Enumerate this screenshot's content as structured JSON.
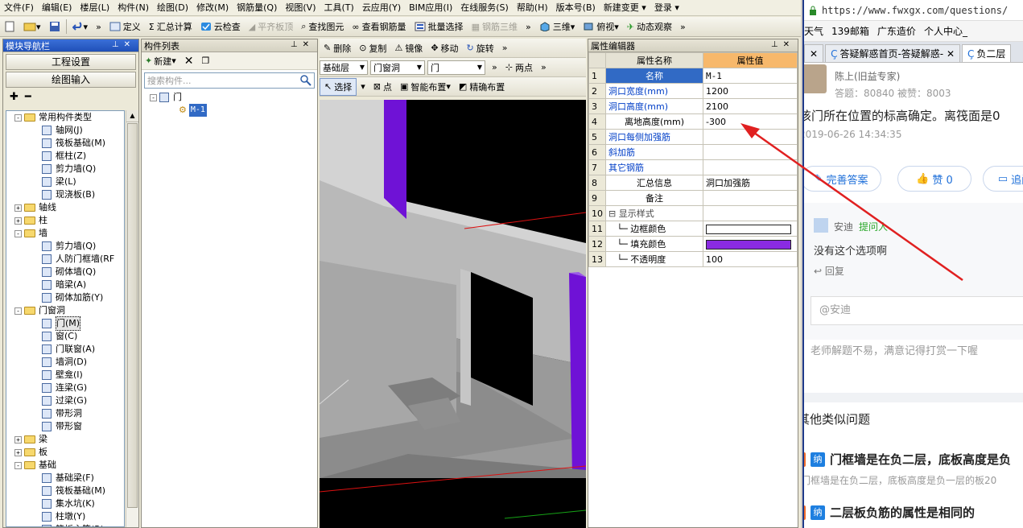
{
  "menu": [
    "文件(F)",
    "编辑(E)",
    "楼层(L)",
    "构件(N)",
    "绘图(D)",
    "修改(M)",
    "钢筋量(Q)",
    "视图(V)",
    "工具(T)",
    "云应用(Y)",
    "BIM应用(I)",
    "在线服务(S)",
    "帮助(H)",
    "版本号(B)",
    "新建变更 ▾",
    "登录 ▾"
  ],
  "toolbar": {
    "define": "定义",
    "summary": "汇总计算",
    "cloud_check": "云检查",
    "flat_slab": "平齐板顶",
    "find": "查找图元",
    "view_rebar": "查看钢筋量",
    "batch_select": "批量选择",
    "rebar_3d": "钢筋三维",
    "threeD": "三维",
    "topview": "俯视",
    "dynamic": "动态观察"
  },
  "nav": {
    "title": "模块导航栏",
    "btn_project": "工程设置",
    "btn_draw": "绘图输入",
    "tree": [
      {
        "level": 0,
        "pm": "-",
        "folder": true,
        "label": "常用构件类型"
      },
      {
        "level": 1,
        "label": "轴网(J)"
      },
      {
        "level": 1,
        "label": "筏板基础(M)"
      },
      {
        "level": 1,
        "label": "框柱(Z)"
      },
      {
        "level": 1,
        "label": "剪力墙(Q)"
      },
      {
        "level": 1,
        "label": "梁(L)"
      },
      {
        "level": 1,
        "label": "现浇板(B)"
      },
      {
        "level": 0,
        "pm": "+",
        "folder": true,
        "label": "轴线"
      },
      {
        "level": 0,
        "pm": "+",
        "folder": true,
        "label": "柱"
      },
      {
        "level": 0,
        "pm": "-",
        "folder": true,
        "label": "墙"
      },
      {
        "level": 1,
        "label": "剪力墙(Q)"
      },
      {
        "level": 1,
        "label": "人防门框墙(RF"
      },
      {
        "level": 1,
        "label": "砌体墙(Q)"
      },
      {
        "level": 1,
        "label": "暗梁(A)"
      },
      {
        "level": 1,
        "label": "砌体加筋(Y)"
      },
      {
        "level": 0,
        "pm": "-",
        "folder": true,
        "label": "门窗洞"
      },
      {
        "level": 1,
        "label": "门(M)",
        "selected": true
      },
      {
        "level": 1,
        "label": "窗(C)"
      },
      {
        "level": 1,
        "label": "门联窗(A)"
      },
      {
        "level": 1,
        "label": "墙洞(D)"
      },
      {
        "level": 1,
        "label": "壁龛(I)"
      },
      {
        "level": 1,
        "label": "连梁(G)"
      },
      {
        "level": 1,
        "label": "过梁(G)"
      },
      {
        "level": 1,
        "label": "带形洞"
      },
      {
        "level": 1,
        "label": "带形窗"
      },
      {
        "level": 0,
        "pm": "+",
        "folder": true,
        "label": "梁"
      },
      {
        "level": 0,
        "pm": "+",
        "folder": true,
        "label": "板"
      },
      {
        "level": 0,
        "pm": "-",
        "folder": true,
        "label": "基础"
      },
      {
        "level": 1,
        "label": "基础梁(F)"
      },
      {
        "level": 1,
        "label": "筏板基础(M)"
      },
      {
        "level": 1,
        "label": "集水坑(K)"
      },
      {
        "level": 1,
        "label": "柱墩(Y)"
      },
      {
        "level": 1,
        "label": "筏板主筋(R)"
      }
    ]
  },
  "complist": {
    "title": "构件列表",
    "new_label": "新建",
    "search_placeholder": "搜索构件...",
    "root": "门",
    "item": "M-1"
  },
  "view": {
    "delete": "删除",
    "copy": "复制",
    "mirror": "镜像",
    "move": "移动",
    "rotate": "旋转",
    "floor": "基础层",
    "category": "门窗洞",
    "type": "门",
    "twopoint": "两点",
    "select": "选择",
    "point": "点",
    "smart": "智能布置",
    "precise": "精确布置"
  },
  "props": {
    "title": "属性编辑器",
    "col_name": "属性名称",
    "col_value": "属性值",
    "rows": [
      {
        "n": "1",
        "name": "名称",
        "value": "M-1",
        "blue": true,
        "selected": true
      },
      {
        "n": "2",
        "name": "洞口宽度(mm)",
        "value": "1200",
        "blue": true
      },
      {
        "n": "3",
        "name": "洞口高度(mm)",
        "value": "2100",
        "blue": true
      },
      {
        "n": "4",
        "name": "离地高度(mm)",
        "value": "-300",
        "blue": false
      },
      {
        "n": "5",
        "name": "洞口每侧加强筋",
        "value": "",
        "blue": true
      },
      {
        "n": "6",
        "name": "斜加筋",
        "value": "",
        "blue": true
      },
      {
        "n": "7",
        "name": "其它钢筋",
        "value": "",
        "blue": true
      },
      {
        "n": "8",
        "name": "汇总信息",
        "value": "洞口加强筋",
        "blue": false
      },
      {
        "n": "9",
        "name": "备注",
        "value": "",
        "blue": false
      },
      {
        "n": "10",
        "name": "显示样式",
        "value": "",
        "group": true
      },
      {
        "n": "11",
        "name": "边框颜色",
        "value": "",
        "child": true,
        "swatch": "#ffffff"
      },
      {
        "n": "12",
        "name": "填充颜色",
        "value": "",
        "child": true,
        "swatch": "#8a2be2"
      },
      {
        "n": "13",
        "name": "不透明度",
        "value": "100",
        "child": true
      }
    ]
  },
  "browser": {
    "url": "https://www.fwxgx.com/questions/",
    "bookmarks": [
      "天气",
      "139邮箱",
      "广东造价",
      "个人中心_"
    ],
    "tabs": [
      "答疑解惑首页-答疑解惑-",
      "负二层"
    ],
    "user_tag": "陈上(旧益专家)",
    "stats": "答题：80840   被赞：8003",
    "answer_text": "该门所在位置的标高确定。离筏面是0",
    "answer_time": "2019-06-26 14:34:35",
    "improve_btn": "完善答案",
    "like_btn": "赞 0",
    "followup_btn": "追问",
    "commenter": "安迪",
    "commenter_tag": "提问人",
    "comment": "没有这个选项啊",
    "reply": "回复",
    "reply_placeholder": "@安迪",
    "note": "老师解题不易，满意记得打赏一下喔",
    "similar_title": "其他类似问题",
    "q1_badge": "纳",
    "q1_title": "门框墙是在负二层，底板高度是负",
    "q1_desc": "门框墙是在负二层，底板高度是负一层的板20",
    "q2_badge": "纳",
    "q2_title": "二层板负筋的属性是相同的"
  }
}
